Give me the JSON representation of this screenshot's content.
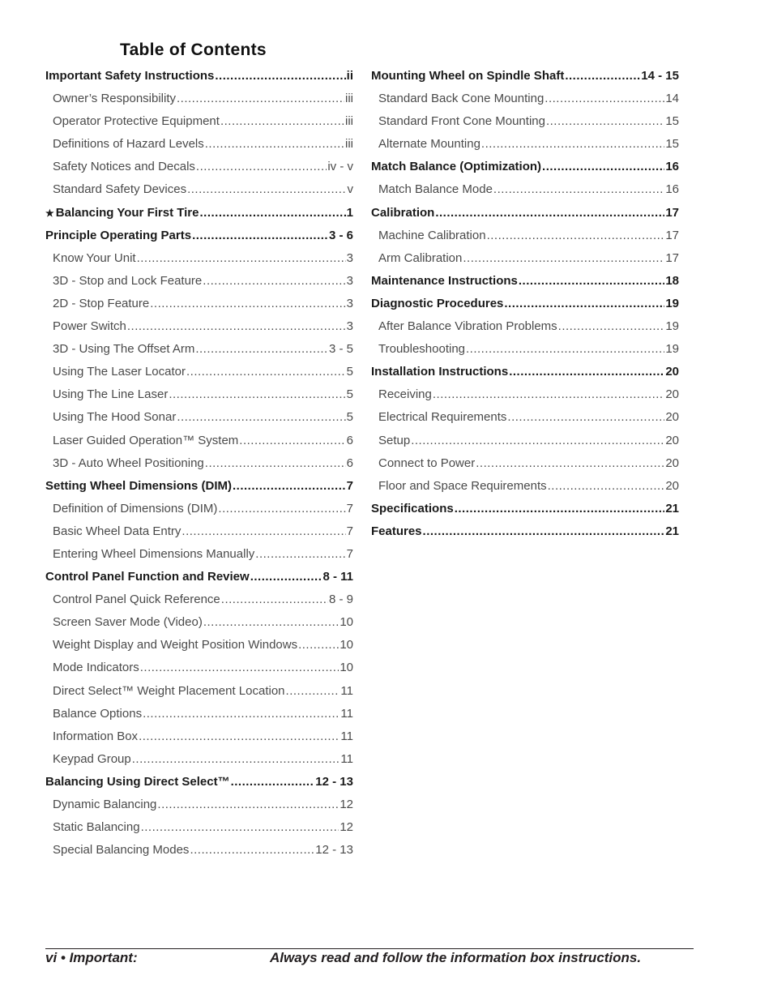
{
  "title": "Table of Contents",
  "left_column": [
    {
      "type": "main",
      "label": "Important Safety Instructions",
      "page": "ii"
    },
    {
      "type": "sub",
      "label": "Owner’s Responsibility",
      "page": "iii"
    },
    {
      "type": "sub",
      "label": "Operator Protective Equipment",
      "page": "iii"
    },
    {
      "type": "sub",
      "label": "Definitions of Hazard Levels",
      "page": "iii"
    },
    {
      "type": "sub",
      "label": "Safety Notices and Decals",
      "page": "iv - v"
    },
    {
      "type": "sub",
      "label": "Standard Safety Devices",
      "page": "v"
    },
    {
      "type": "main",
      "label": "Balancing Your First Tire",
      "page": "1",
      "icon": "star-icon"
    },
    {
      "type": "main",
      "label": "Principle Operating Parts",
      "page": "3 - 6"
    },
    {
      "type": "sub",
      "label": "Know Your Unit",
      "page": "3"
    },
    {
      "type": "sub",
      "label": "3D - Stop and Lock Feature",
      "page": "3"
    },
    {
      "type": "sub",
      "label": "2D - Stop Feature",
      "page": "3"
    },
    {
      "type": "sub",
      "label": "Power Switch",
      "page": "3"
    },
    {
      "type": "sub",
      "label": "3D - Using The Offset Arm",
      "page": "3 - 5"
    },
    {
      "type": "sub",
      "label": "Using The Laser Locator",
      "page": "5"
    },
    {
      "type": "sub",
      "label": "Using The Line Laser",
      "page": "5"
    },
    {
      "type": "sub",
      "label": "Using The Hood Sonar",
      "page": "5"
    },
    {
      "type": "sub",
      "label": "Laser Guided Operation™ System",
      "page": "6"
    },
    {
      "type": "sub",
      "label": "3D - Auto Wheel Positioning",
      "page": "6"
    },
    {
      "type": "main",
      "label": "Setting Wheel Dimensions (DIM)",
      "page": "7"
    },
    {
      "type": "sub",
      "label": "Definition of Dimensions (DIM)",
      "page": "7"
    },
    {
      "type": "sub",
      "label": "Basic Wheel Data Entry",
      "page": "7"
    },
    {
      "type": "sub",
      "label": "Entering Wheel Dimensions Manually",
      "page": "7"
    },
    {
      "type": "main",
      "label": "Control Panel Function and Review",
      "page": "8 - 11"
    },
    {
      "type": "sub",
      "label": "Control Panel Quick Reference",
      "page": "8 - 9"
    },
    {
      "type": "sub",
      "label": "Screen Saver Mode (Video)",
      "page": "10"
    },
    {
      "type": "sub",
      "label": "Weight Display and Weight Position Windows",
      "page": "10"
    },
    {
      "type": "sub",
      "label": "Mode Indicators",
      "page": "10"
    },
    {
      "type": "sub",
      "label": "Direct Select™ Weight Placement Location",
      "page": "11"
    },
    {
      "type": "sub",
      "label": "Balance Options",
      "page": "11"
    },
    {
      "type": "sub",
      "label": "Information Box",
      "page": "11"
    },
    {
      "type": "sub",
      "label": "Keypad Group",
      "page": "11"
    },
    {
      "type": "main",
      "label": "Balancing Using Direct Select™",
      "page": "12 - 13"
    },
    {
      "type": "sub",
      "label": "Dynamic Balancing",
      "page": "12"
    },
    {
      "type": "sub",
      "label": "Static Balancing",
      "page": "12"
    },
    {
      "type": "sub",
      "label": "Special Balancing Modes",
      "page": "12 - 13"
    }
  ],
  "right_column": [
    {
      "type": "main",
      "label": "Mounting Wheel on Spindle Shaft",
      "page": "14 - 15"
    },
    {
      "type": "sub",
      "label": "Standard Back Cone Mounting",
      "page": "14"
    },
    {
      "type": "sub",
      "label": "Standard Front Cone Mounting",
      "page": "15"
    },
    {
      "type": "sub",
      "label": "Alternate Mounting",
      "page": "15"
    },
    {
      "type": "main",
      "label": "Match Balance (Optimization)",
      "page": "16"
    },
    {
      "type": "sub",
      "label": "Match Balance Mode",
      "page": "16"
    },
    {
      "type": "main",
      "label": "Calibration",
      "page": "17"
    },
    {
      "type": "sub",
      "label": "Machine Calibration",
      "page": "17"
    },
    {
      "type": "sub",
      "label": "Arm Calibration",
      "page": "17"
    },
    {
      "type": "main",
      "label": "Maintenance Instructions",
      "page": "18"
    },
    {
      "type": "main",
      "label": "Diagnostic Procedures",
      "page": "19"
    },
    {
      "type": "sub",
      "label": "After Balance Vibration Problems",
      "page": "19"
    },
    {
      "type": "sub",
      "label": "Troubleshooting",
      "page": "19"
    },
    {
      "type": "main",
      "label": "Installation Instructions",
      "page": "20"
    },
    {
      "type": "sub",
      "label": "Receiving",
      "page": "20"
    },
    {
      "type": "sub",
      "label": "Electrical Requirements",
      "page": "20"
    },
    {
      "type": "sub",
      "label": "Setup",
      "page": "20"
    },
    {
      "type": "sub",
      "label": "Connect to Power",
      "page": "20"
    },
    {
      "type": "sub",
      "label": "Floor and Space Requirements",
      "page": "20"
    },
    {
      "type": "main",
      "label": "Specifications",
      "page": "21"
    },
    {
      "type": "main",
      "label": "Features",
      "page": "21"
    }
  ],
  "footer": {
    "left": "vi • Important:",
    "right": "Always read and follow the information box instructions."
  },
  "icons": {
    "star-icon": "★"
  }
}
